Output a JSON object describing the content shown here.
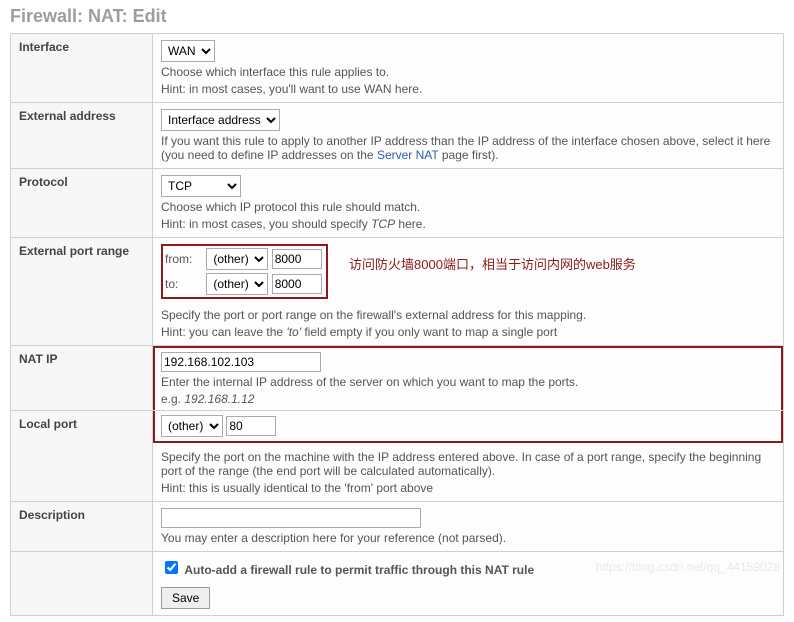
{
  "page": {
    "title": "Firewall: NAT: Edit"
  },
  "interface": {
    "label": "Interface",
    "value": "WAN",
    "hint1": "Choose which interface this rule applies to.",
    "hint2": "Hint: in most cases, you'll want to use WAN here."
  },
  "external_addr": {
    "label": "External address",
    "value": "Interface address",
    "hint1": "If you want this rule to apply to another IP address than the IP address of the interface chosen above, select it here (you need to define IP addresses on the ",
    "link": "Server NAT",
    "hint2": " page first)."
  },
  "protocol": {
    "label": "Protocol",
    "value": "TCP",
    "hint1": "Choose which IP protocol this rule should match.",
    "hint2_pre": "Hint: in most cases, you should specify ",
    "hint2_em": "TCP",
    "hint2_post": " here."
  },
  "ext_port": {
    "label": "External port range",
    "from_label": "from:",
    "to_label": "to:",
    "from_sel": "(other)",
    "to_sel": "(other)",
    "from_val": "8000",
    "to_val": "8000",
    "annotation": "访问防火墙8000端口，相当于访问内网的web服务",
    "hint1": "Specify the port or port range on the firewall's external address for this mapping.",
    "hint2_pre": "Hint: you can leave the ",
    "hint2_em": "'to'",
    "hint2_post": " field empty if you only want to map a single port"
  },
  "nat_ip": {
    "label": "NAT IP",
    "value": "192.168.102.103",
    "hint1": "Enter the internal IP address of the server on which you want to map the ports.",
    "hint2_pre": "e.g. ",
    "hint2_em": "192.168.1.12"
  },
  "local_port": {
    "label": "Local port",
    "sel": "(other)",
    "value": "80",
    "hint1": "Specify the port on the machine with the IP address entered above. In case of a port range, specify the beginning port of the range (the end port will be calculated automatically).",
    "hint2": "Hint: this is usually identical to the 'from' port above"
  },
  "description": {
    "label": "Description",
    "value": "",
    "hint": "You may enter a description here for your reference (not parsed)."
  },
  "autoadd": {
    "label": "Auto-add a firewall rule to permit traffic through this NAT rule",
    "checked": true
  },
  "save": {
    "label": "Save"
  },
  "watermark": "https://blog.csdn.net/qq_44159028"
}
